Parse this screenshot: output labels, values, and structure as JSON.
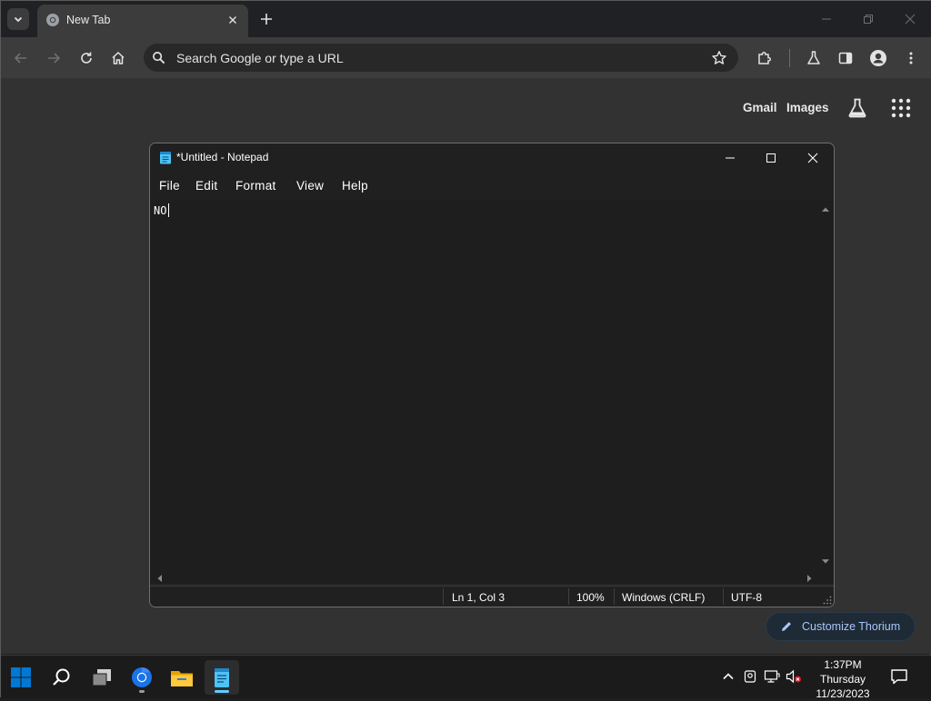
{
  "browser": {
    "tab": {
      "title": "New Tab"
    },
    "omnibox": {
      "placeholder": "Search Google or type a URL"
    }
  },
  "ntp": {
    "gmail_label": "Gmail",
    "images_label": "Images",
    "customize_label": "Customize Thorium"
  },
  "notepad": {
    "title": "*Untitled - Notepad",
    "menu": [
      "File",
      "Edit",
      "Format",
      "View",
      "Help"
    ],
    "content": "NO",
    "status": {
      "position": "Ln 1, Col 3",
      "zoom": "100%",
      "line_ending": "Windows (CRLF)",
      "encoding": "UTF-8"
    }
  },
  "taskbar": {
    "apps": [
      "start-icon",
      "search-icon",
      "task-view-icon",
      "chrome-icon",
      "file-explorer-icon",
      "notepad-icon"
    ],
    "clock": {
      "time": "1:37PM",
      "day": "Thursday",
      "date": "11/23/2023"
    }
  },
  "colors": {
    "accent_blue": "#a8c7fa",
    "taskbar_indicator": "#60cdff",
    "windows_blue": "#0078d4"
  }
}
